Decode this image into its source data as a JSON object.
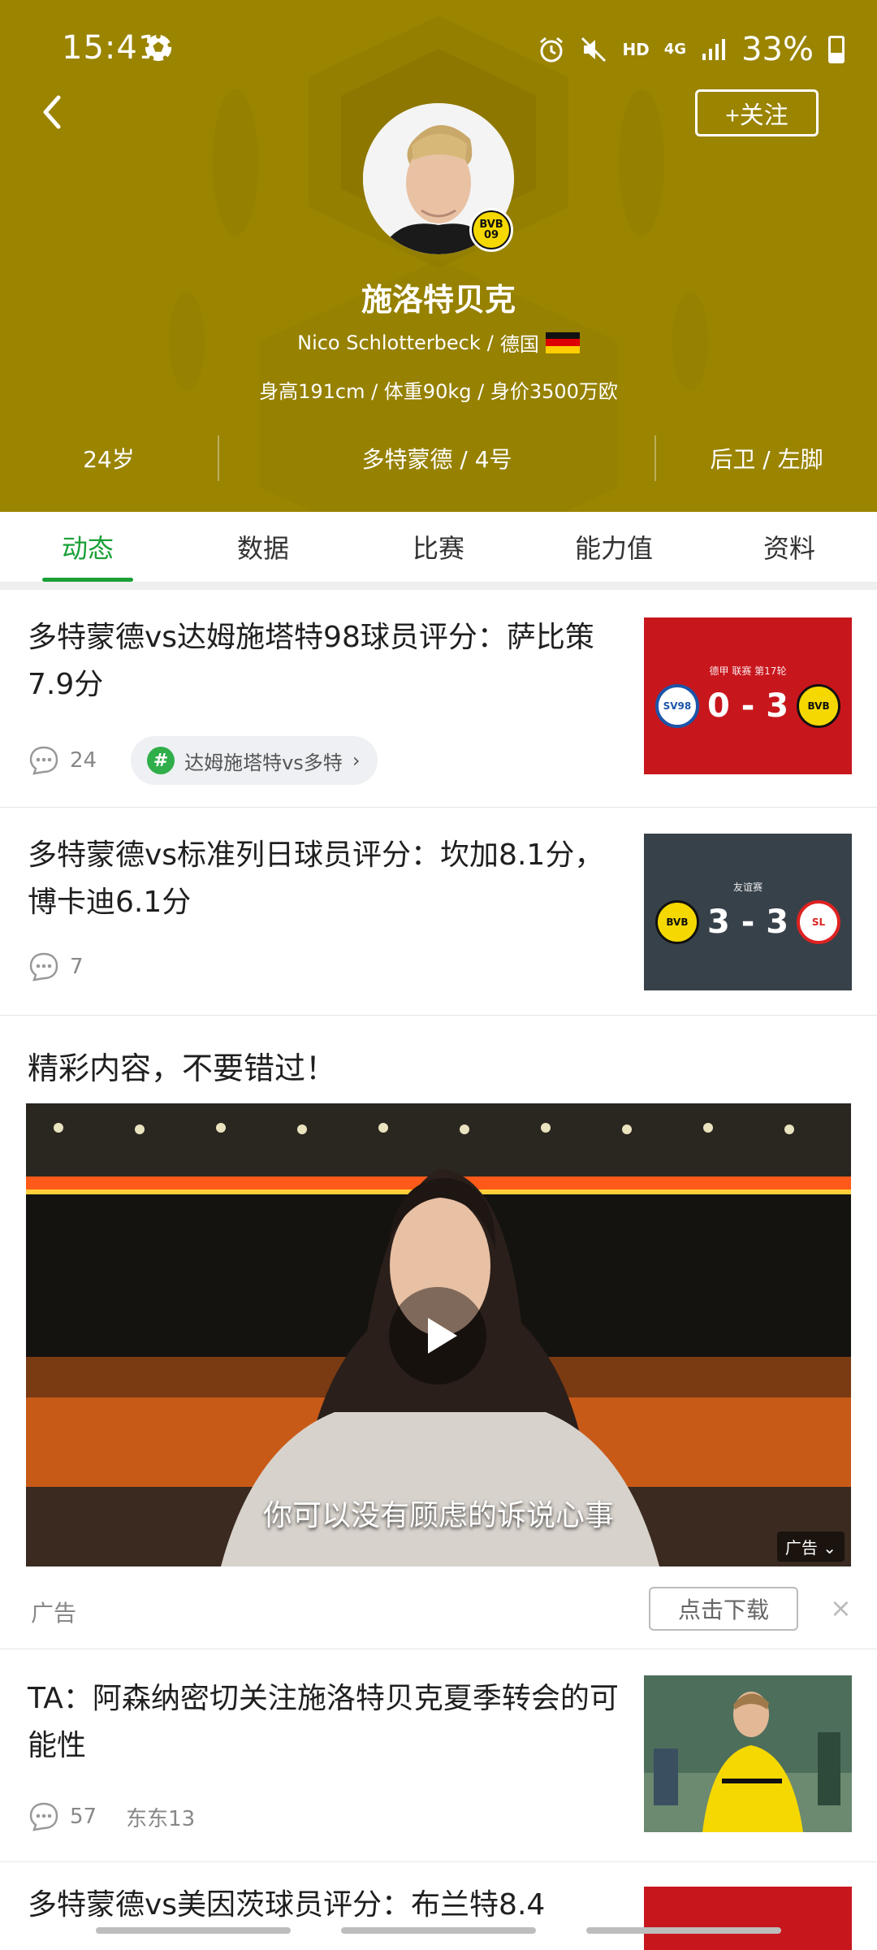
{
  "status_bar": {
    "time": "15:41",
    "network": "HD",
    "signal_type": "4G",
    "battery": "33%"
  },
  "header": {
    "follow_label": "+关注",
    "player_name": "施洛特贝克",
    "player_en": "Nico Schlotterbeck",
    "nationality": "德国",
    "stats_line": "身高191cm / 体重90kg / 身价3500万欧",
    "age": "24岁",
    "club_number": "多特蒙德 / 4号",
    "position": "后卫 / 左脚",
    "club_badge_top": "BVB",
    "club_badge_bottom": "09"
  },
  "tabs": [
    {
      "label": "动态",
      "active": true
    },
    {
      "label": "数据",
      "active": false
    },
    {
      "label": "比赛",
      "active": false
    },
    {
      "label": "能力值",
      "active": false
    },
    {
      "label": "资料",
      "active": false
    }
  ],
  "feed": {
    "items": [
      {
        "title": "多特蒙德vs达姆施塔特98球员评分：萨比策7.9分",
        "comments": "24",
        "topic": "达姆施塔特vs多特",
        "thumb_label": "德甲 联赛 第17轮",
        "score": "0 - 3"
      },
      {
        "title": "多特蒙德vs标准列日球员评分：坎加8.1分，博卡迪6.1分",
        "comments": "7",
        "thumb_label": "友谊赛",
        "score": "3 - 3"
      }
    ],
    "promo_title": "精彩内容，不要错过！",
    "video_caption": "你可以没有顾虑的诉说心事",
    "video_ad_tag": "广告",
    "ad_label": "广告",
    "download_label": "点击下载",
    "close_symbol": "×",
    "item3": {
      "title": "TA：阿森纳密切关注施洛特贝克夏季转会的可能性",
      "comments": "57",
      "source": "东东13"
    },
    "item4": {
      "title": "多特蒙德vs美因茨球员评分：布兰特8.4"
    }
  },
  "colors": {
    "header_bg": "#9a8400",
    "accent_green": "#1aa037",
    "bvb_yellow": "#f5d800"
  }
}
